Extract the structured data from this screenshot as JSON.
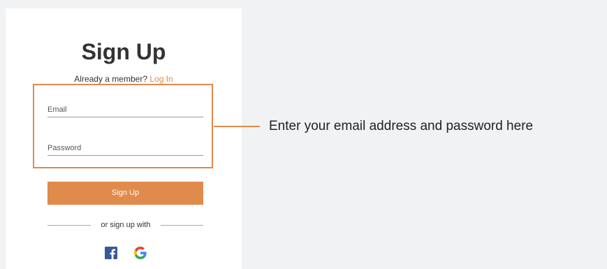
{
  "header": {
    "title": "Sign Up",
    "member_prompt": "Already a member?",
    "login_link": "Log In"
  },
  "form": {
    "email_label": "Email",
    "password_label": "Password",
    "submit_label": "Sign Up"
  },
  "social": {
    "divider_text": "or sign up with",
    "providers": [
      "facebook-icon",
      "google-icon"
    ]
  },
  "annotation": {
    "text": "Enter your email address and password here"
  },
  "colors": {
    "accent": "#e08a4c",
    "background": "#f1f2f4",
    "facebook": "#3b5998"
  }
}
